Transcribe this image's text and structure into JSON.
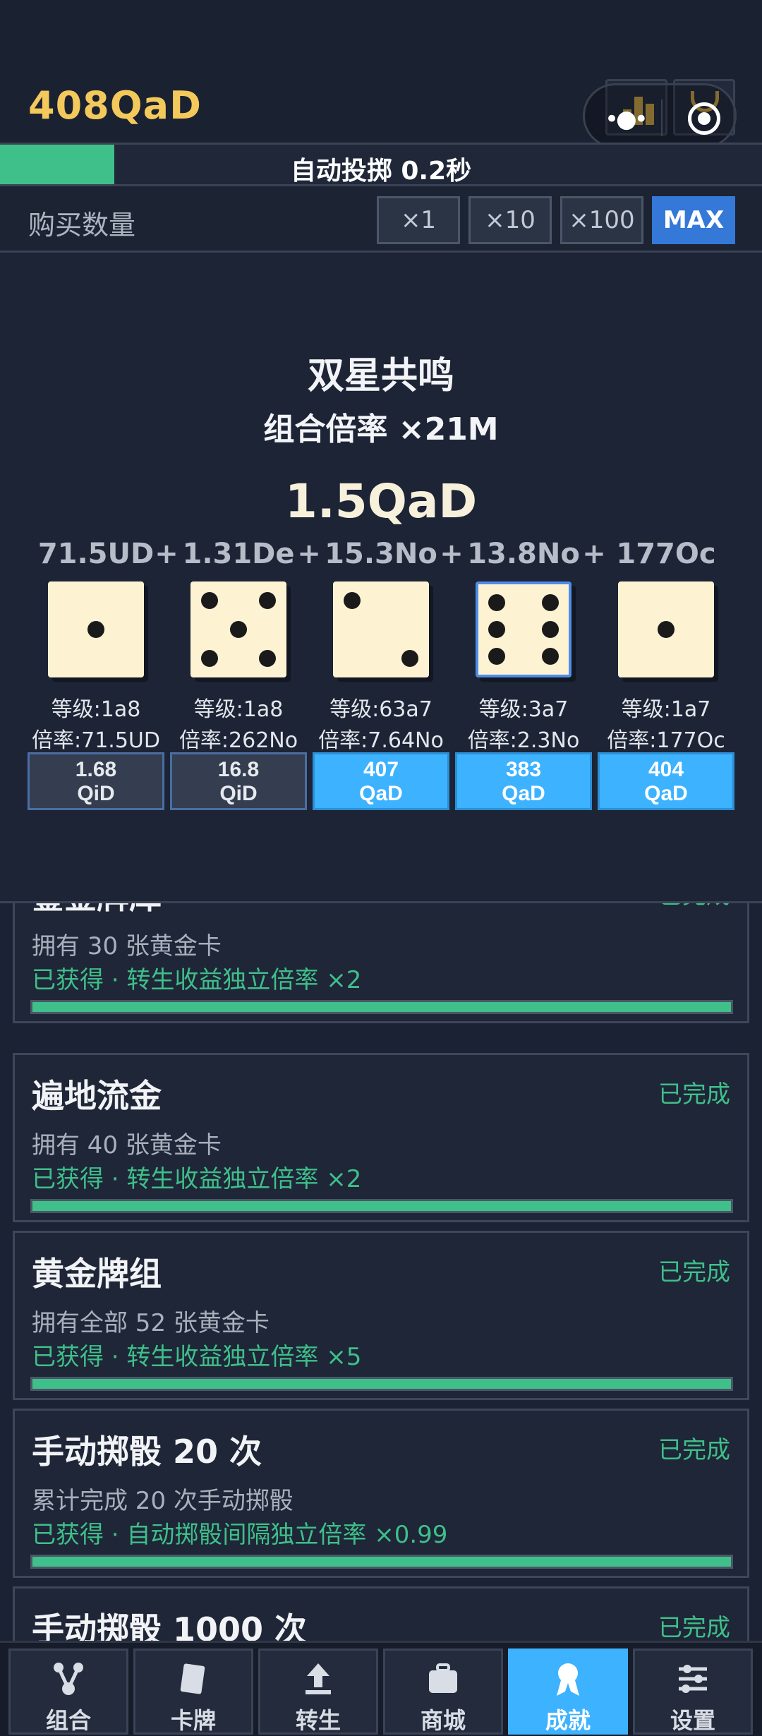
{
  "header": {
    "currency": "408QaD",
    "capsule": {
      "menu_glyph": "•●•"
    }
  },
  "auto_roll": {
    "label": "自动投掷 0.2秒",
    "progress": 0.15
  },
  "buy": {
    "label": "购买数量",
    "options": [
      {
        "label": "×1",
        "active": false
      },
      {
        "label": "×10",
        "active": false
      },
      {
        "label": "×100",
        "active": false
      },
      {
        "label": "MAX",
        "active": true
      }
    ]
  },
  "combo": {
    "name": "双星共鸣",
    "multiplier": "组合倍率 ×21M",
    "total": "1.5QaD",
    "terms": [
      "71.5UD",
      "1.31De",
      "15.3No",
      "13.8No",
      "177Oc"
    ],
    "plus": "+"
  },
  "dice": [
    {
      "face": 1,
      "level": "等级:1a8",
      "rate": "倍率:71.5UD",
      "upgrade_line1": "1.68",
      "upgrade_line2": "QiD",
      "affordable": false,
      "selected": false
    },
    {
      "face": 5,
      "level": "等级:1a8",
      "rate": "倍率:262No",
      "upgrade_line1": "16.8",
      "upgrade_line2": "QiD",
      "affordable": false,
      "selected": false
    },
    {
      "face": 2,
      "level": "等级:63a7",
      "rate": "倍率:7.64No",
      "upgrade_line1": "407",
      "upgrade_line2": "QaD",
      "affordable": true,
      "selected": false
    },
    {
      "face": 6,
      "level": "等级:3a7",
      "rate": "倍率:2.3No",
      "upgrade_line1": "383",
      "upgrade_line2": "QaD",
      "affordable": true,
      "selected": true
    },
    {
      "face": 1,
      "level": "等级:1a7",
      "rate": "倍率:177Oc",
      "upgrade_line1": "404",
      "upgrade_line2": "QaD",
      "affordable": true,
      "selected": false
    }
  ],
  "achievements": [
    {
      "title": "鎏金牌库",
      "status": "已完成",
      "desc": "拥有 30 张黄金卡",
      "reward": "已获得 · 转生收益独立倍率 ×2",
      "progress": 1.0
    },
    {
      "title": "遍地流金",
      "status": "已完成",
      "desc": "拥有 40 张黄金卡",
      "reward": "已获得 · 转生收益独立倍率 ×2",
      "progress": 1.0
    },
    {
      "title": "黄金牌组",
      "status": "已完成",
      "desc": "拥有全部 52 张黄金卡",
      "reward": "已获得 · 转生收益独立倍率 ×5",
      "progress": 1.0
    },
    {
      "title": "手动掷骰 20 次",
      "status": "已完成",
      "desc": "累计完成 20 次手动掷骰",
      "reward": "已获得 · 自动掷骰间隔独立倍率 ×0.99",
      "progress": 1.0
    },
    {
      "title": "手动掷骰 1000 次",
      "status": "已完成",
      "desc": "",
      "reward": "",
      "progress": 1.0
    }
  ],
  "nav": [
    {
      "label": "组合",
      "icon": "combo-icon",
      "active": false
    },
    {
      "label": "卡牌",
      "icon": "cards-icon",
      "active": false
    },
    {
      "label": "转生",
      "icon": "rebirth-icon",
      "active": false
    },
    {
      "label": "商城",
      "icon": "shop-icon",
      "active": false
    },
    {
      "label": "成就",
      "icon": "achievement-icon",
      "active": true
    },
    {
      "label": "设置",
      "icon": "settings-icon",
      "active": false
    }
  ],
  "colors": {
    "accent_green": "#3fbf8a",
    "accent_blue": "#3db2ff",
    "currency_gold": "#f4c95b",
    "max_button": "#3478d8"
  }
}
